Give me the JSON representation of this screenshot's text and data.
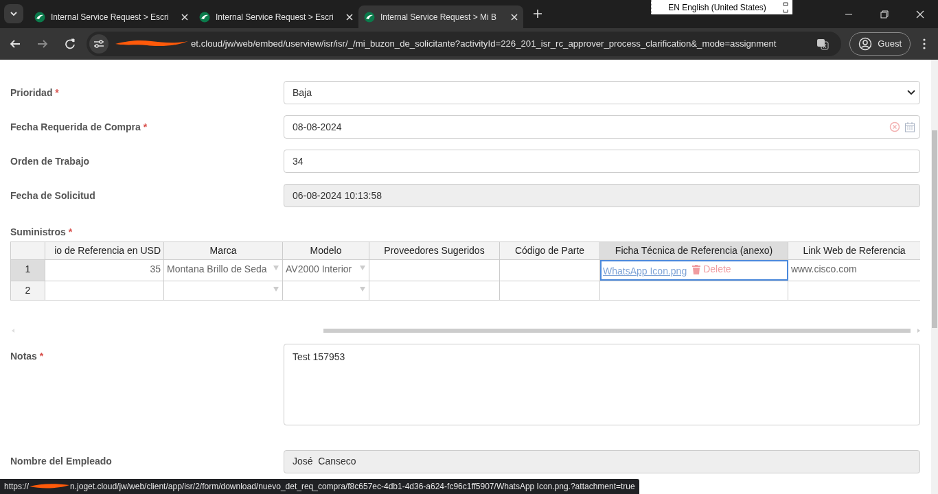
{
  "browser": {
    "tabs": [
      {
        "title": "Internal Service Request > Escri",
        "selected": false
      },
      {
        "title": "Internal Service Request > Escri",
        "selected": false
      },
      {
        "title": "Internal Service Request > Mi B",
        "selected": true
      }
    ],
    "language_bar": "EN English (United States)",
    "url": "et.cloud/jw/web/embed/userview/isr/isr/_/mi_buzon_de_solicitante?activityId=226_201_isr_rc_approver_process_clarification&_mode=assignment",
    "profile": "Guest"
  },
  "form": {
    "fields": [
      {
        "label": "Prioridad",
        "required_mark": "*",
        "kind": "select",
        "value": "Baja"
      },
      {
        "label": "Fecha Requerida de Compra",
        "required_mark": "*",
        "kind": "date",
        "value": "08-08-2024"
      },
      {
        "label": "Orden de Trabajo",
        "kind": "text",
        "value": "34"
      },
      {
        "label": "Fecha de Solicitud",
        "kind": "readonly",
        "value": "06-08-2024 10:13:58"
      }
    ],
    "grid": {
      "label": "Suministros",
      "required_mark": "*",
      "columns": [
        {
          "label": "io de Referencia en USD",
          "selected": false
        },
        {
          "label": "Marca",
          "selected": false
        },
        {
          "label": "Modelo",
          "selected": false
        },
        {
          "label": "Proveedores Sugeridos",
          "selected": false
        },
        {
          "label": "Código de Parte",
          "selected": false
        },
        {
          "label": "Ficha Técnica de Referencia (anexo)",
          "selected": true
        },
        {
          "label": "Link Web de Referencia",
          "selected": false
        }
      ],
      "rows": [
        {
          "number": "1",
          "selected": true,
          "cells": [
            {
              "kind": "number",
              "text": "35"
            },
            {
              "kind": "dropdown",
              "text": "Montana Brillo de Seda"
            },
            {
              "kind": "dropdown",
              "text": "AV2000 Interior"
            },
            {
              "kind": "text"
            },
            {
              "kind": "text"
            },
            {
              "kind": "file",
              "text": "WhatsApp Icon.png",
              "action": "Delete"
            },
            {
              "kind": "text",
              "text": "www.cisco.com"
            }
          ]
        },
        {
          "number": "2",
          "selected": false,
          "cells": [
            {
              "kind": "number"
            },
            {
              "kind": "dropdown"
            },
            {
              "kind": "dropdown"
            },
            {
              "kind": "text"
            },
            {
              "kind": "text"
            },
            {
              "kind": "text"
            },
            {
              "kind": "text"
            }
          ]
        }
      ]
    },
    "notes": {
      "label": "Notas",
      "required_mark": "*",
      "value": "Test 157953"
    },
    "employee": {
      "label": "Nombre del Empleado",
      "value": "José  Canseco"
    }
  },
  "status_bar": {
    "prefix": "https://",
    "text": "n.joget.cloud/jw/web/client/app/isr/2/form/download/nuevo_det_req_compra/f8c657ec-4db1-4d36-a624-fc96c1ff5907/WhatsApp Icon.png.?attachment=true"
  }
}
